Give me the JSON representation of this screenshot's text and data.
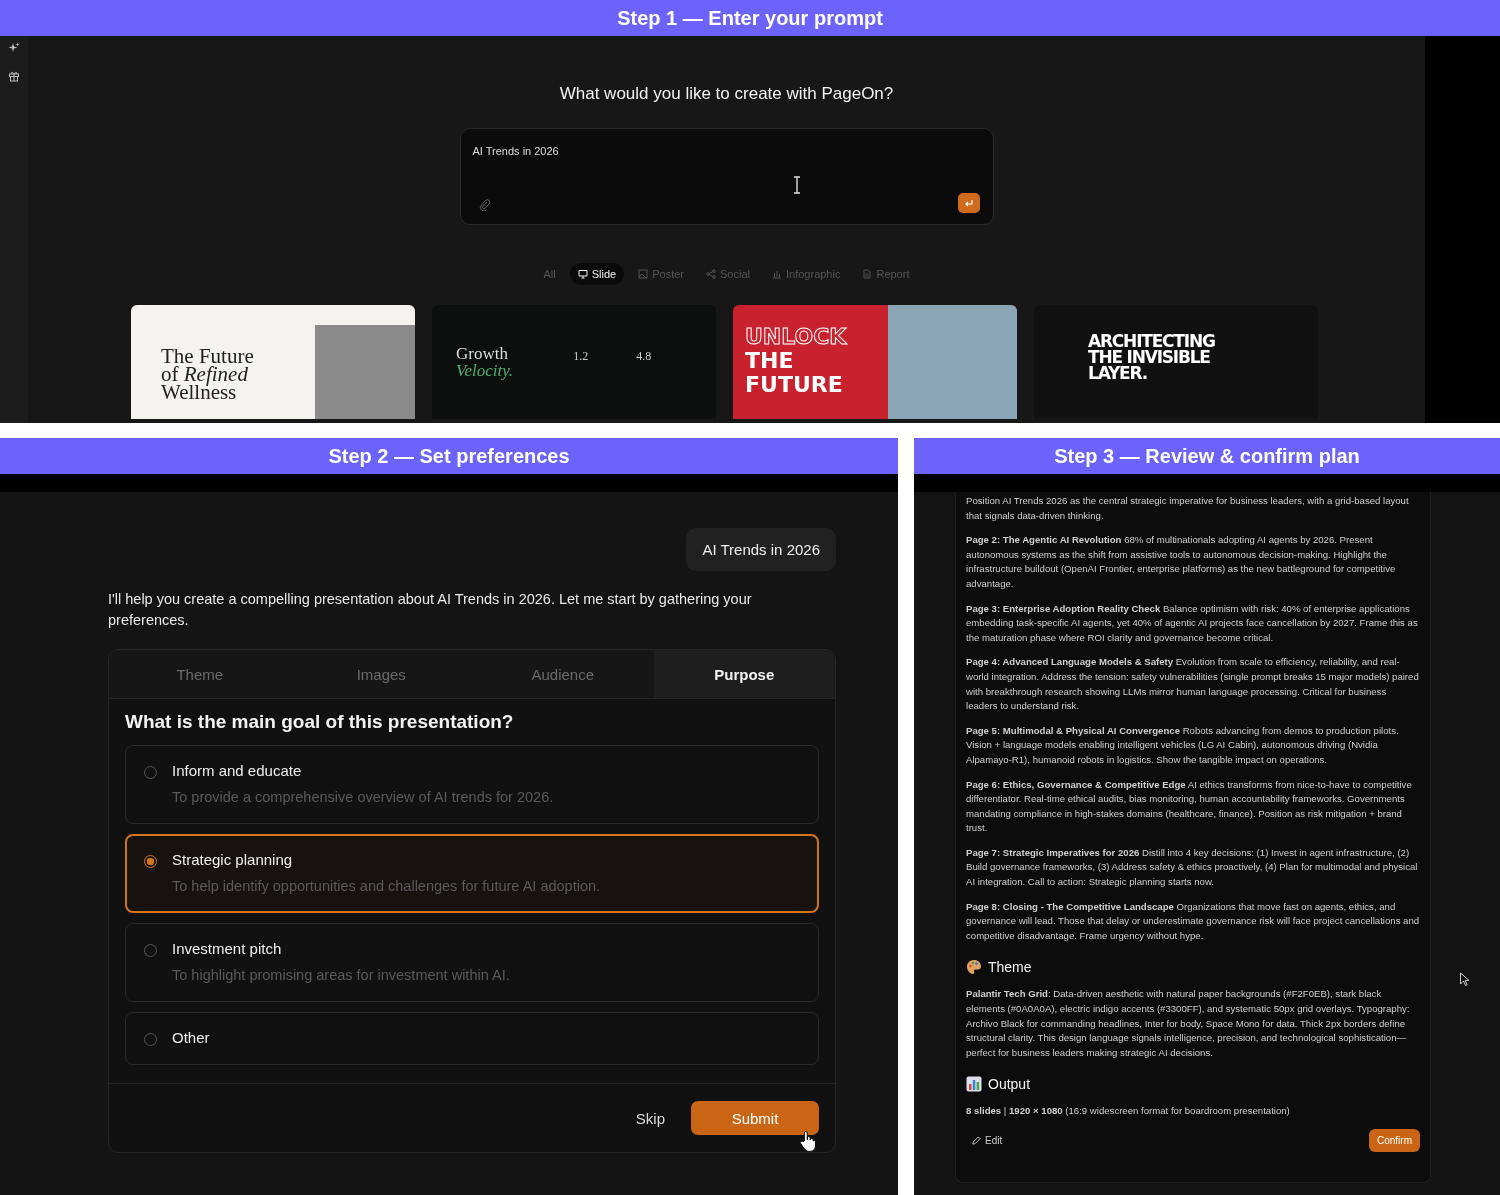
{
  "step1": {
    "header": "Step 1 — Enter your prompt",
    "heading": "What would you like to create with PageOn?",
    "prompt": {
      "value": "AI Trends in 2026"
    },
    "filters": [
      {
        "label": "All",
        "kind": "all",
        "selected": false
      },
      {
        "label": "Slide",
        "kind": "slide",
        "selected": true
      },
      {
        "label": "Poster",
        "kind": "poster",
        "selected": false
      },
      {
        "label": "Social",
        "kind": "social",
        "selected": false
      },
      {
        "label": "Infographic",
        "kind": "infographic",
        "selected": false
      },
      {
        "label": "Report",
        "kind": "report",
        "selected": false
      }
    ],
    "templates": [
      {
        "kind": "editorial",
        "lines": [
          "The Future",
          "of *Refined*",
          "Wellness"
        ]
      },
      {
        "kind": "dashboard",
        "lines": [
          "Growth",
          "Velocity."
        ],
        "stats": [
          "1.2",
          "4.8"
        ]
      },
      {
        "kind": "poster",
        "lines": [
          "UNLOCK",
          "THE",
          "FUTURE"
        ]
      },
      {
        "kind": "typographic",
        "lines": [
          "ARCHITECTING",
          "THE INVISIBLE",
          "LAYER."
        ]
      }
    ]
  },
  "step2": {
    "header": "Step 2 — Set preferences",
    "user_message": "AI Trends in 2026",
    "intro": "I'll help you create a compelling presentation about AI Trends in 2026. Let me start by gathering your preferences.",
    "tabs": [
      {
        "label": "Theme",
        "selected": false
      },
      {
        "label": "Images",
        "selected": false
      },
      {
        "label": "Audience",
        "selected": false
      },
      {
        "label": "Purpose",
        "selected": true
      }
    ],
    "question": "What is the main goal of this presentation?",
    "options": [
      {
        "title": "Inform and educate",
        "description": "To provide a comprehensive overview of AI trends for 2026.",
        "selected": false
      },
      {
        "title": "Strategic planning",
        "description": "To help identify opportunities and challenges for future AI adoption.",
        "selected": true
      },
      {
        "title": "Investment pitch",
        "description": "To highlight promising areas for investment within AI.",
        "selected": false
      },
      {
        "title": "Other",
        "selected": false
      }
    ],
    "skip": "Skip",
    "submit": "Submit"
  },
  "step3": {
    "header": "Step 3 — Review & confirm plan",
    "plan": [
      "Position AI Trends 2026 as the central strategic imperative for business leaders, with a grid-based layout that signals data-driven thinking.",
      "**Page 2: The Agentic AI Revolution** 68% of multinationals adopting AI agents by 2026. Present autonomous systems as the shift from assistive tools to autonomous decision-making. Highlight the infrastructure buildout (OpenAI Frontier, enterprise platforms) as the new battleground for competitive advantage.",
      "**Page 3: Enterprise Adoption Reality Check** Balance optimism with risk: 40% of enterprise applications embedding task-specific AI agents, yet 40% of agentic AI projects face cancellation by 2027. Frame this as the maturation phase where ROI clarity and governance become critical.",
      "**Page 4: Advanced Language Models & Safety** Evolution from scale to efficiency, reliability, and real-world integration. Address the tension: safety vulnerabilities (single prompt breaks 15 major models) paired with breakthrough research showing LLMs mirror human language processing. Critical for business leaders to understand risk.",
      "**Page 5: Multimodal & Physical AI Convergence** Robots advancing from demos to production pilots. Vision + language models enabling intelligent vehicles (LG AI Cabin), autonomous driving (Nvidia Alpamayo-R1), humanoid robots in logistics. Show the tangible impact on operations.",
      "**Page 6: Ethics, Governance & Competitive Edge** AI ethics transforms from nice-to-have to competitive differentiator. Real-time ethical audits, bias monitoring, human accountability frameworks. Governments mandating compliance in high-stakes domains (healthcare, finance). Position as risk mitigation + brand trust.",
      "**Page 7: Strategic Imperatives for 2026** Distill into 4 key decisions: (1) Invest in agent infrastructure, (2) Build governance frameworks, (3) Address safety & ethics proactively, (4) Plan for multimodal and physical AI integration. Call to action: Strategic planning starts now.",
      "**Page 8: Closing - The Competitive Landscape** Organizations that move fast on agents, ethics, and governance will lead. Those that delay or underestimate governance risk will face project cancellations and competitive disadvantage. Frame urgency without hype."
    ],
    "theme": {
      "heading": "Theme",
      "text": "**Palantir Tech Grid**: Data-driven aesthetic with natural paper backgrounds (#F2F0EB), stark black elements (#0A0A0A), electric indigo accents (#3300FF), and systematic 50px grid overlays. Typography: Archivo Black for commanding headlines, Inter for body, Space Mono for data. Thick 2px borders define structural clarity. This design language signals intelligence, precision, and technological sophistication—perfect for business leaders making strategic AI decisions."
    },
    "output": {
      "heading": "Output",
      "text": "**8 slides** | **1920 × 1080** (16:9 widescreen format for boardroom presentation)"
    },
    "edit": "Edit",
    "confirm": "Confirm"
  }
}
